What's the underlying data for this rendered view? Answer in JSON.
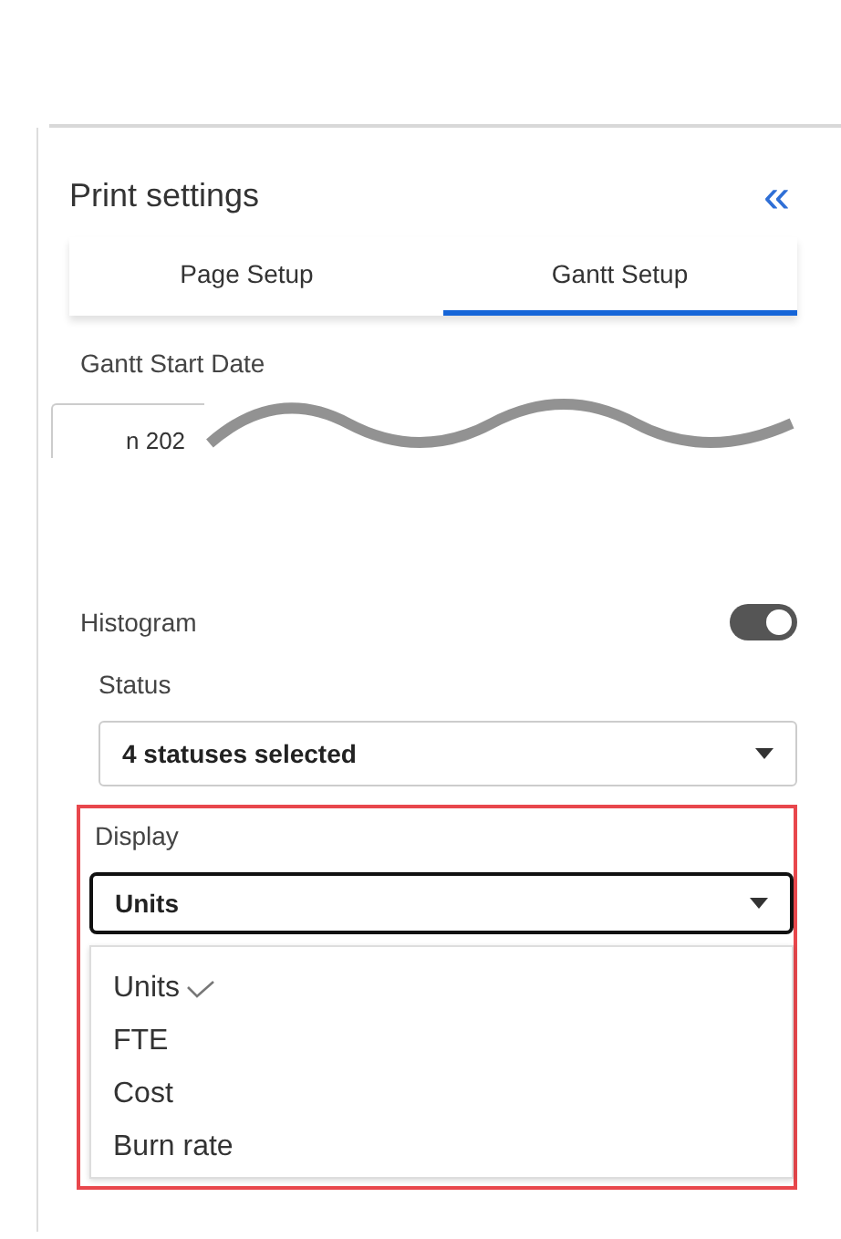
{
  "panel": {
    "title": "Print settings",
    "collapse_icon": "«"
  },
  "tabs": [
    {
      "label": "Page Setup",
      "selected": false
    },
    {
      "label": "Gantt Setup",
      "selected": true
    }
  ],
  "start_date": {
    "label": "Gantt Start Date",
    "value": "n 202"
  },
  "histogram": {
    "label": "Histogram",
    "on": true
  },
  "status": {
    "label": "Status",
    "value": "4 statuses selected"
  },
  "display": {
    "label": "Display",
    "value": "Units",
    "highlighted": true,
    "options": [
      {
        "label": "Units",
        "selected": true
      },
      {
        "label": "FTE",
        "selected": false
      },
      {
        "label": "Cost",
        "selected": false
      },
      {
        "label": "Burn rate",
        "selected": false
      }
    ]
  }
}
